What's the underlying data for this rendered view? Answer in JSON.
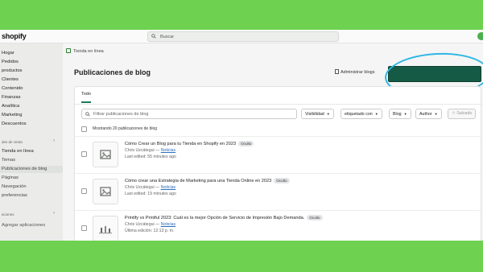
{
  "brand": {
    "logo_text": "shopify"
  },
  "search": {
    "placeholder": "Buscar"
  },
  "sidebar": {
    "items": [
      {
        "label": "Hogar"
      },
      {
        "label": "Pedidos"
      },
      {
        "label": "productos"
      },
      {
        "label": "Clientes"
      },
      {
        "label": "Contenido"
      },
      {
        "label": "Finanzas"
      },
      {
        "label": "Analítica"
      },
      {
        "label": "Marketing"
      },
      {
        "label": "Descuentos"
      }
    ],
    "channels_header": "des de venta",
    "channel_items": [
      {
        "label": "Tienda en línea"
      },
      {
        "label": "Temas"
      },
      {
        "label": "Publicaciones de blog"
      },
      {
        "label": "Páginas"
      },
      {
        "label": "Navegación"
      },
      {
        "label": "preferencias"
      }
    ],
    "apps_header": "aciones",
    "add_apps": "Agregar aplicaciones"
  },
  "breadcrumb": {
    "label": "Tienda en línea"
  },
  "page": {
    "title": "Publicaciones de blog",
    "manage_blogs": "Administrar blogs"
  },
  "tabs": [
    {
      "label": "Todo"
    }
  ],
  "filters": {
    "search_placeholder": "Filtrar publicaciones de blog",
    "visibility": "Visibilidad",
    "tagged_with": "etiquetado con",
    "blog": "Blog",
    "author": "Author",
    "saved": "Salvado"
  },
  "list": {
    "showing": "Mostrando 20 publicaciones de blog",
    "posts": [
      {
        "title": "Cómo Crear un Blog para tu Tienda en Shopify en 2023",
        "badge": "Oculto",
        "author": "Chris Uzcátegui —",
        "blog": "Noticias",
        "edited": "Last edited: 55 minutes ago"
      },
      {
        "title": "Cómo crear una Estrategia de Marketing para una Tienda Online en 2023",
        "badge": "Oculto",
        "author": "Chris Uzcátegui —",
        "blog": "Noticias",
        "edited": "Last edited: 19 minutes ago"
      },
      {
        "title": "Printify vs Printful 2023: Cuál es la mejor Opción de Servicio de Impresión Bajo Demanda.",
        "badge": "Oculto",
        "author": "Chris Uzcátegui —",
        "blog": "Noticias",
        "edited": "Última edición: 12:13 p. m."
      }
    ]
  },
  "colors": {
    "background": "#6ed150",
    "create_button": "#155a44",
    "highlight_circle": "#2fb6e6",
    "tab_underline": "#1a7a5c"
  }
}
